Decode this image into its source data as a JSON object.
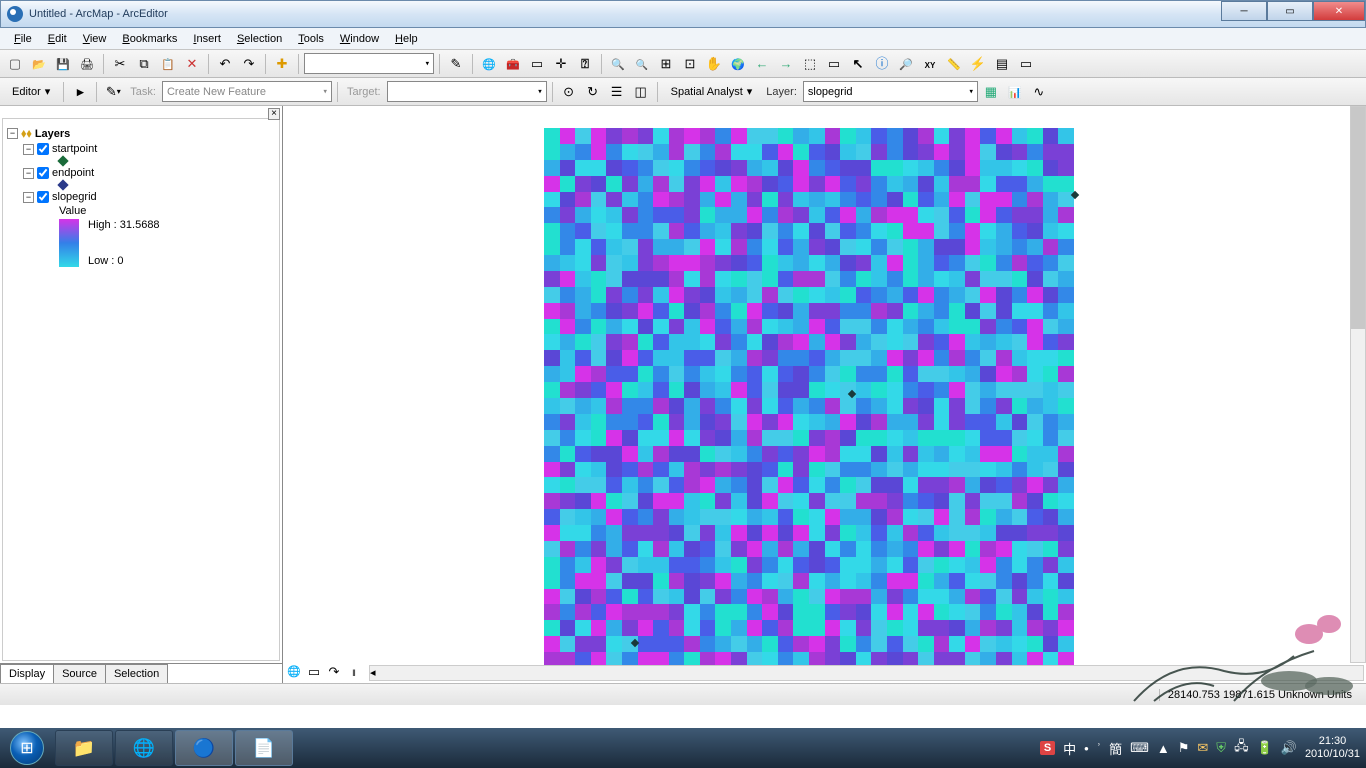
{
  "window": {
    "title": "Untitled - ArcMap - ArcEditor"
  },
  "menu": {
    "file": "File",
    "edit": "Edit",
    "view": "View",
    "bookmarks": "Bookmarks",
    "insert": "Insert",
    "selection": "Selection",
    "tools": "Tools",
    "window": "Window",
    "help": "Help"
  },
  "toolbar": {
    "scale": "",
    "editor": "Editor",
    "task_label": "Task:",
    "task_value": "Create New Feature",
    "target_label": "Target:",
    "target_value": "",
    "sa_label": "Spatial Analyst",
    "layer_label": "Layer:",
    "layer_value": "slopegrid"
  },
  "toc": {
    "root": "Layers",
    "layers": [
      {
        "name": "startpoint",
        "checked": true,
        "expanded": true,
        "sym": "pt-green"
      },
      {
        "name": "endpoint",
        "checked": true,
        "expanded": true,
        "sym": "pt-blue"
      },
      {
        "name": "slopegrid",
        "checked": true,
        "expanded": true,
        "sym": "gradient",
        "value_label": "Value",
        "high": "High : 31.5688",
        "low": "Low : 0"
      }
    ],
    "tabs": {
      "display": "Display",
      "source": "Source",
      "selection": "Selection"
    }
  },
  "status": {
    "coords": "28140.753  19871.615 Unknown Units"
  },
  "tray": {
    "time": "21:30",
    "date": "2010/10/31",
    "ime1": "S",
    "ime2": "中",
    "ime3": "簡"
  }
}
